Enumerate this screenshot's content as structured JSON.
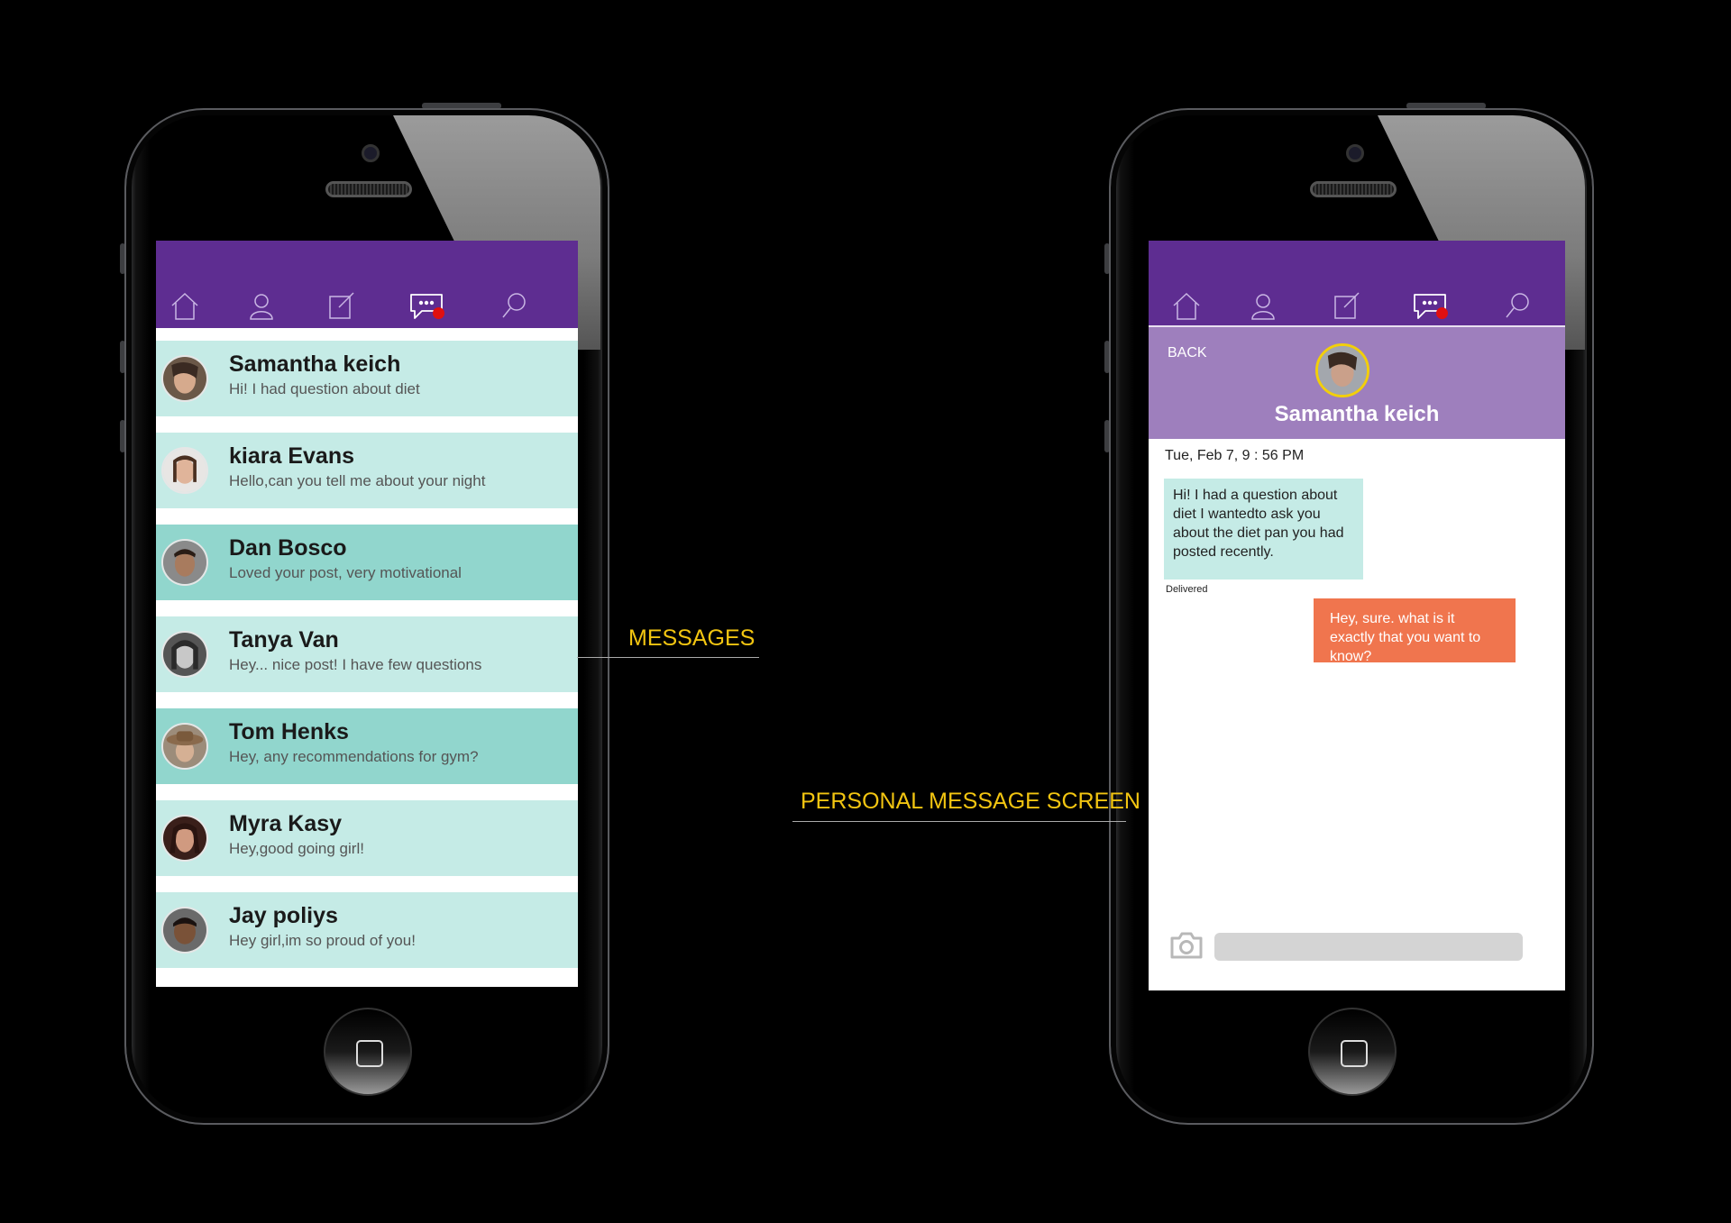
{
  "nav": {
    "icons": [
      "home-icon",
      "user-icon",
      "compose-icon",
      "messages-icon",
      "search-icon"
    ],
    "accent": "#5e2d91",
    "badge_color": "#e01010"
  },
  "messages_screen": {
    "conversations": [
      {
        "name": "Samantha keich",
        "preview": "Hi! I had question about diet",
        "tone": "light"
      },
      {
        "name": "kiara Evans",
        "preview": "Hello,can you tell me about your night",
        "tone": "light"
      },
      {
        "name": "Dan Bosco",
        "preview": "Loved your post, very motivational",
        "tone": "dark"
      },
      {
        "name": "Tanya Van",
        "preview": "Hey... nice post! I have few questions",
        "tone": "light"
      },
      {
        "name": "Tom Henks",
        "preview": "Hey, any recommendations for gym?",
        "tone": "dark"
      },
      {
        "name": "Myra Kasy",
        "preview": "Hey,good going girl!",
        "tone": "light"
      },
      {
        "name": "Jay poliys",
        "preview": "Hey girl,im so proud of you!",
        "tone": "light"
      }
    ],
    "colors": {
      "row_light": "#c5ebe6",
      "row_dark": "#91d6cd"
    }
  },
  "chat_screen": {
    "back_label": "BACK",
    "contact_name": "Samantha keich",
    "date": "Tue, Feb 7, 9 : 56 PM",
    "incoming_message": "Hi! I had a question about diet I wantedto ask you about the diet pan you had posted recently.",
    "delivered_label": "Delivered",
    "outgoing_message": "Hey, sure. what is it exactly that you want to know?",
    "input_placeholder": "",
    "colors": {
      "header": "#9e7fbd",
      "avatar_ring": "#f2cf0a",
      "outgoing": "#f0754e",
      "incoming": "#c5ebe6"
    }
  },
  "callouts": {
    "messages": "MESSAGES",
    "personal": "PERSONAL MESSAGE SCREEN",
    "color": "#f2c511"
  }
}
